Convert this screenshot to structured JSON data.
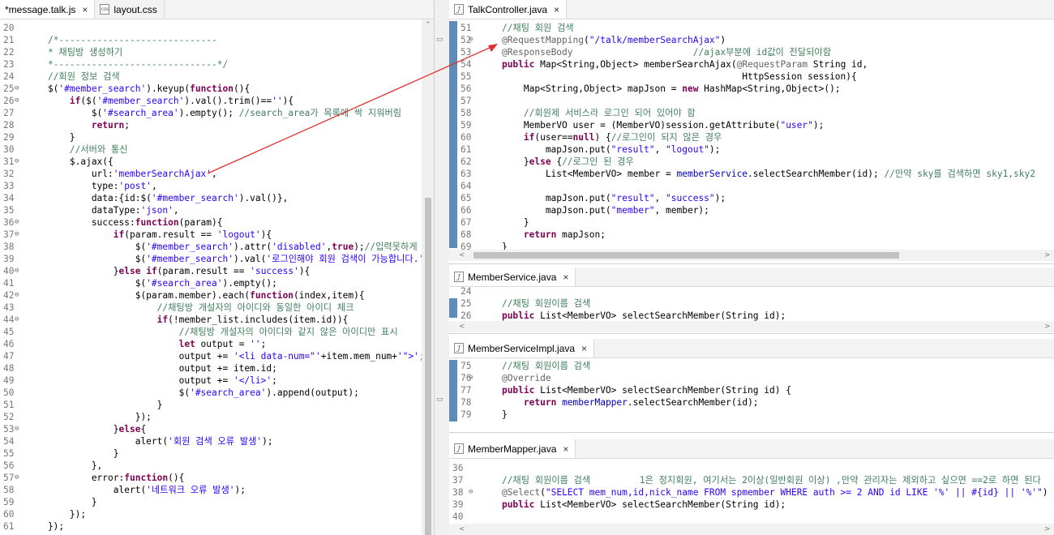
{
  "left_editor": {
    "tabs": [
      {
        "label": "*message.talk.js",
        "active": true
      },
      {
        "label": "layout.css",
        "active": false
      }
    ],
    "lines": [
      {
        "n": "20",
        "fold": false,
        "text": ""
      },
      {
        "n": "21",
        "fold": false,
        "text": "    /*-----------------------------"
      },
      {
        "n": "22",
        "fold": false,
        "text": "    * 채팅방 생성하기"
      },
      {
        "n": "23",
        "fold": false,
        "text": "    *------------------------------*/"
      },
      {
        "n": "24",
        "fold": false,
        "text": "    //회원 정보 검색"
      },
      {
        "n": "25",
        "fold": true,
        "text": "    $('#member_search').keyup(function(){"
      },
      {
        "n": "26",
        "fold": true,
        "text": "        if($('#member_search').val().trim()==''){"
      },
      {
        "n": "27",
        "fold": false,
        "text": "            $('#search_area').empty(); //search_area가 목록에 싹 지워버림"
      },
      {
        "n": "28",
        "fold": false,
        "text": "            return;"
      },
      {
        "n": "29",
        "fold": false,
        "text": "        }"
      },
      {
        "n": "30",
        "fold": false,
        "text": "        //서버와 통신"
      },
      {
        "n": "31",
        "fold": true,
        "text": "        $.ajax({"
      },
      {
        "n": "32",
        "fold": false,
        "text": "            url:'memberSearchAjax',"
      },
      {
        "n": "33",
        "fold": false,
        "text": "            type:'post',"
      },
      {
        "n": "34",
        "fold": false,
        "text": "            data:{id:$('#member_search').val()},"
      },
      {
        "n": "35",
        "fold": false,
        "text": "            dataType:'json',"
      },
      {
        "n": "36",
        "fold": true,
        "text": "            success:function(param){"
      },
      {
        "n": "37",
        "fold": true,
        "text": "                if(param.result == 'logout'){"
      },
      {
        "n": "38",
        "fold": false,
        "text": "                    $('#member_search').attr('disabled',true);//입력못하게 d"
      },
      {
        "n": "39",
        "fold": false,
        "text": "                    $('#member_search').val('로그인해야 회원 검색이 가능합니다.');"
      },
      {
        "n": "40",
        "fold": true,
        "text": "                }else if(param.result == 'success'){"
      },
      {
        "n": "41",
        "fold": false,
        "text": "                    $('#search_area').empty();"
      },
      {
        "n": "42",
        "fold": true,
        "text": "                    $(param.member).each(function(index,item){"
      },
      {
        "n": "43",
        "fold": false,
        "text": "                        //채팅방 개설자의 아이디와 동일한 아이디 체크"
      },
      {
        "n": "44",
        "fold": true,
        "text": "                        if(!member_list.includes(item.id)){"
      },
      {
        "n": "45",
        "fold": false,
        "text": "                            //채팅방 개설자의 아이디와 같지 않은 아이디만 표시"
      },
      {
        "n": "46",
        "fold": false,
        "text": "                            let output = '';"
      },
      {
        "n": "47",
        "fold": false,
        "text": "                            output += '<li data-num=\"'+item.mem_num+'\">';"
      },
      {
        "n": "48",
        "fold": false,
        "text": "                            output += item.id;"
      },
      {
        "n": "49",
        "fold": false,
        "text": "                            output += '</li>';"
      },
      {
        "n": "50",
        "fold": false,
        "text": "                            $('#search_area').append(output);"
      },
      {
        "n": "51",
        "fold": false,
        "text": "                        }"
      },
      {
        "n": "52",
        "fold": false,
        "text": "                    });"
      },
      {
        "n": "53",
        "fold": true,
        "text": "                }else{"
      },
      {
        "n": "54",
        "fold": false,
        "text": "                    alert('회원 검색 오류 발생');"
      },
      {
        "n": "55",
        "fold": false,
        "text": "                }"
      },
      {
        "n": "56",
        "fold": false,
        "text": "            },"
      },
      {
        "n": "57",
        "fold": true,
        "text": "            error:function(){"
      },
      {
        "n": "58",
        "fold": false,
        "text": "                alert('네트워크 오류 발생');"
      },
      {
        "n": "59",
        "fold": false,
        "text": "            }"
      },
      {
        "n": "60",
        "fold": false,
        "text": "        });"
      },
      {
        "n": "61",
        "fold": false,
        "text": "    });"
      }
    ]
  },
  "talk_controller": {
    "tab": "TalkController.java",
    "lines": [
      {
        "n": "51",
        "fold": false,
        "text": "    //채팅 회원 검색"
      },
      {
        "n": "52",
        "fold": true,
        "text": "    @RequestMapping(\"/talk/memberSearchAjax\")"
      },
      {
        "n": "53",
        "fold": false,
        "text": "    @ResponseBody                      //ajax부분에 id값이 전달되야함"
      },
      {
        "n": "54",
        "fold": false,
        "text": "    public Map<String,Object> memberSearchAjax(@RequestParam String id,"
      },
      {
        "n": "55",
        "fold": false,
        "text": "                                                HttpSession session){"
      },
      {
        "n": "56",
        "fold": false,
        "text": "        Map<String,Object> mapJson = new HashMap<String,Object>();"
      },
      {
        "n": "57",
        "fold": false,
        "text": ""
      },
      {
        "n": "58",
        "fold": false,
        "text": "        //회원제 서비스라 로그인 되어 있어야 함"
      },
      {
        "n": "59",
        "fold": false,
        "text": "        MemberVO user = (MemberVO)session.getAttribute(\"user\");"
      },
      {
        "n": "60",
        "fold": false,
        "text": "        if(user==null) {//로그인이 되지 않은 경우"
      },
      {
        "n": "61",
        "fold": false,
        "text": "            mapJson.put(\"result\", \"logout\");"
      },
      {
        "n": "62",
        "fold": false,
        "text": "        }else {//로그인 된 경우"
      },
      {
        "n": "63",
        "fold": false,
        "text": "            List<MemberVO> member = memberService.selectSearchMember(id); //만약 sky를 검색하면 sky1,sky2"
      },
      {
        "n": "64",
        "fold": false,
        "text": ""
      },
      {
        "n": "65",
        "fold": false,
        "text": "            mapJson.put(\"result\", \"success\");"
      },
      {
        "n": "66",
        "fold": false,
        "text": "            mapJson.put(\"member\", member);"
      },
      {
        "n": "67",
        "fold": false,
        "text": "        }"
      },
      {
        "n": "68",
        "fold": false,
        "text": "        return mapJson;"
      },
      {
        "n": "69",
        "fold": false,
        "text": "    }"
      }
    ]
  },
  "member_service": {
    "tab": "MemberService.java",
    "lines": [
      {
        "n": "24",
        "fold": false,
        "text": ""
      },
      {
        "n": "25",
        "fold": false,
        "text": "    //채팅 회원이름 검색"
      },
      {
        "n": "26",
        "fold": false,
        "text": "    public List<MemberVO> selectSearchMember(String id);"
      }
    ]
  },
  "member_service_impl": {
    "tab": "MemberServiceImpl.java",
    "lines": [
      {
        "n": "75",
        "fold": false,
        "text": "    //채팅 회원이름 검색"
      },
      {
        "n": "76",
        "fold": true,
        "text": "    @Override"
      },
      {
        "n": "77",
        "fold": false,
        "text": "    public List<MemberVO> selectSearchMember(String id) {"
      },
      {
        "n": "78",
        "fold": false,
        "text": "        return memberMapper.selectSearchMember(id);"
      },
      {
        "n": "79",
        "fold": false,
        "text": "    }"
      }
    ]
  },
  "member_mapper": {
    "tab": "MemberMapper.java",
    "lines": [
      {
        "n": "36",
        "fold": false,
        "text": ""
      },
      {
        "n": "37",
        "fold": false,
        "text": "    //채팅 회원이름 검색         1은 정지회원, 여기서는 2이상(일반회원 이상) ,만약 관리자는 제외하고 싶으면 ==2로 하면 된다"
      },
      {
        "n": "38",
        "fold": true,
        "text": "    @Select(\"SELECT mem_num,id,nick_name FROM spmember WHERE auth >= 2 AND id LIKE '%' || #{id} || '%'\")"
      },
      {
        "n": "39",
        "fold": false,
        "text": "    public List<MemberVO> selectSearchMember(String id);"
      },
      {
        "n": "40",
        "fold": false,
        "text": ""
      }
    ]
  },
  "icons": {
    "close": "×",
    "fold": "⊖",
    "java_file": "J",
    "css_file": "css",
    "arrow_left": "<",
    "arrow_right": ">",
    "arrow_up": "^",
    "arrow_down": "v"
  },
  "colors": {
    "keyword": "#7f0055",
    "string": "#2a00ff",
    "comment": "#3f7f5f",
    "annotation": "#646464",
    "field": "#0000c0",
    "annotation_arrow": "#e03030"
  }
}
